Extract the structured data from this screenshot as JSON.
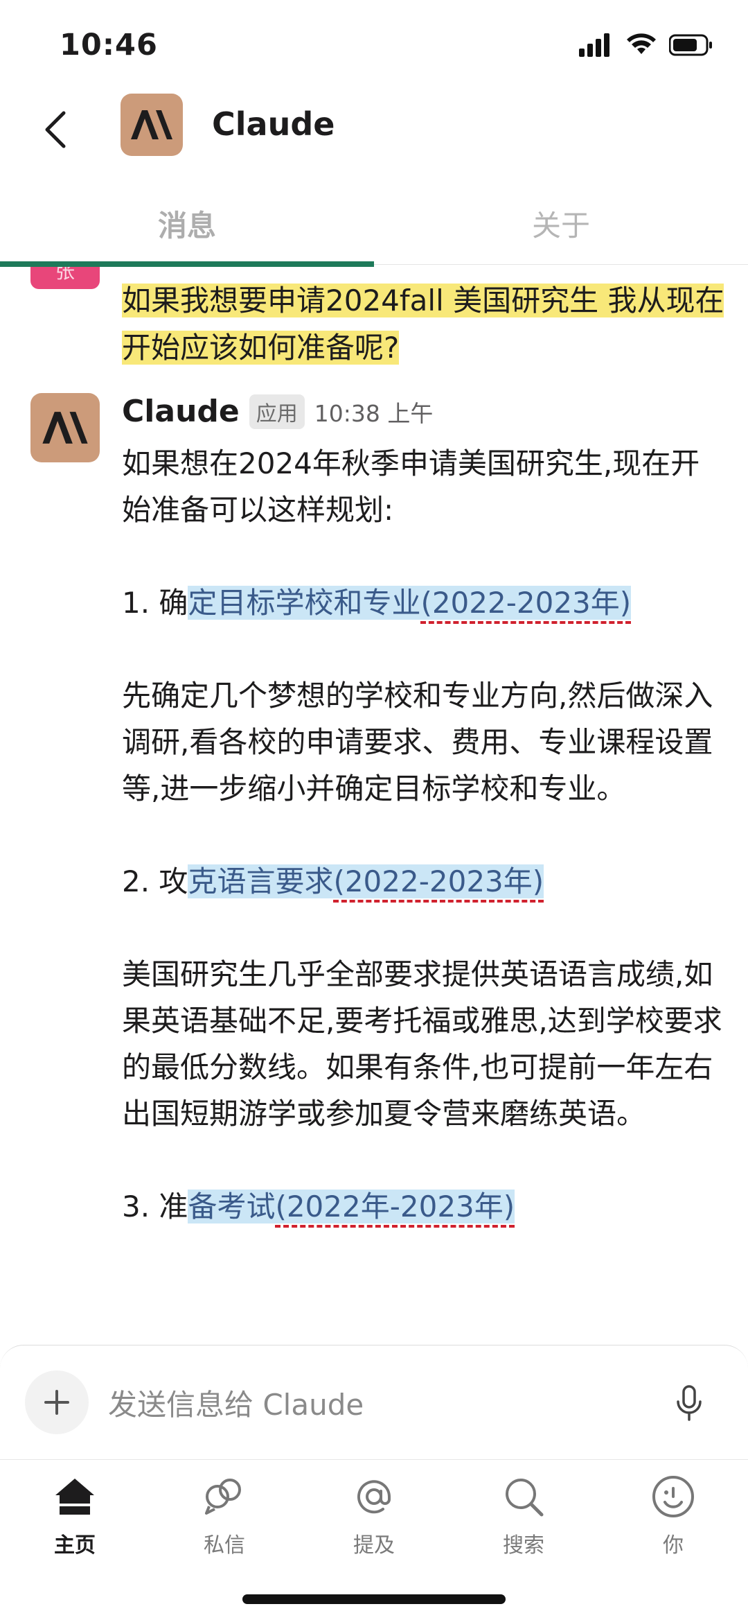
{
  "status_bar": {
    "time": "10:46"
  },
  "header": {
    "title": "Claude"
  },
  "tabs": [
    {
      "label": "消息",
      "active": true
    },
    {
      "label": "关于",
      "active": false
    }
  ],
  "user_message": {
    "avatar_initial": "张",
    "text": "如果我想要申请2024fall 美国研究生 我从现在开始应该如何准备呢?"
  },
  "claude_message": {
    "name": "Claude",
    "badge": "应用",
    "time": "10:38 上午",
    "intro": "如果想在2024年秋季申请美国研究生,现在开始准备可以这样规划:",
    "sections": [
      {
        "title_prefix": "1. 确",
        "title_highlight": "定目标学校和专业",
        "title_date": "(2022-2023年)",
        "body": "先确定几个梦想的学校和专业方向,然后做深入调研,看各校的申请要求、费用、专业课程设置等,进一步缩小并确定目标学校和专业。"
      },
      {
        "title_prefix": "2. 攻",
        "title_highlight": "克语言要求",
        "title_date": "(2022-2023年)",
        "body": "美国研究生几乎全部要求提供英语语言成绩,如果英语基础不足,要考托福或雅思,达到学校要求的最低分数线。如果有条件,也可提前一年左右出国短期游学或参加夏令营来磨练英语。"
      },
      {
        "title_prefix": "3. 准",
        "title_highlight": "备考试",
        "title_date": "(2022年-2023年)",
        "body": ""
      }
    ]
  },
  "composer": {
    "placeholder": "发送信息给 Claude"
  },
  "bottom_nav": [
    {
      "label": "主页",
      "icon": "home-icon",
      "active": true
    },
    {
      "label": "私信",
      "icon": "dm-icon",
      "active": false
    },
    {
      "label": "提及",
      "icon": "mention-icon",
      "active": false
    },
    {
      "label": "搜索",
      "icon": "search-icon",
      "active": false
    },
    {
      "label": "你",
      "icon": "profile-icon",
      "active": false
    }
  ],
  "colors": {
    "claude_avatar_bg": "#cc9b7a",
    "tab_underline": "#1e7a5a",
    "highlight_yellow": "#f8e879",
    "highlight_blue": "#cbe6f6",
    "squiggle_red": "#d0212e"
  }
}
